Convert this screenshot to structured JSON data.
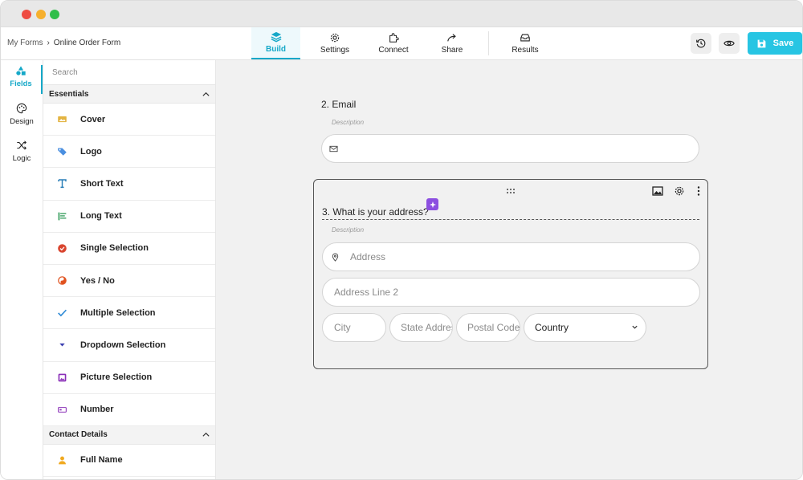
{
  "breadcrumb": {
    "root": "My Forms",
    "separator": "›",
    "current": "Online Order Form"
  },
  "nav_tabs": [
    {
      "label": "Build",
      "icon": "layers-icon",
      "active": true
    },
    {
      "label": "Settings",
      "icon": "gear-icon",
      "active": false
    },
    {
      "label": "Connect",
      "icon": "puzzle-icon",
      "active": false
    },
    {
      "label": "Share",
      "icon": "share-arrow-icon",
      "active": false
    },
    {
      "label": "Results",
      "icon": "inbox-icon",
      "active": false
    }
  ],
  "toolbar": {
    "history_icon": "history-icon",
    "preview_icon": "eye-icon",
    "save_label": "Save",
    "save_icon": "floppy-disk-icon"
  },
  "rail": [
    {
      "label": "Fields",
      "icon": "shapes-icon",
      "active": true
    },
    {
      "label": "Design",
      "icon": "palette-icon",
      "active": false
    },
    {
      "label": "Logic",
      "icon": "shuffle-icon",
      "active": false
    }
  ],
  "panel": {
    "search_placeholder": "Search",
    "sections": [
      {
        "title": "Essentials",
        "expanded": true,
        "items": [
          {
            "label": "Cover",
            "icon": "image-icon",
            "color": "#e3b341"
          },
          {
            "label": "Logo",
            "icon": "tag-icon",
            "color": "#4a8fe0"
          },
          {
            "label": "Short Text",
            "icon": "text-t-icon",
            "color": "#2a7fb8"
          },
          {
            "label": "Long Text",
            "icon": "align-left-icon",
            "color": "#2f9a57"
          },
          {
            "label": "Single Selection",
            "icon": "check-circle-icon",
            "color": "#d9452f"
          },
          {
            "label": "Yes / No",
            "icon": "yes-no-icon",
            "color": "#e0521f"
          },
          {
            "label": "Multiple Selection",
            "icon": "checkmark-icon",
            "color": "#2e8ad6"
          },
          {
            "label": "Dropdown Selection",
            "icon": "caret-down-icon",
            "color": "#3b3fb0"
          },
          {
            "label": "Picture Selection",
            "icon": "picture-icon",
            "color": "#8a2fb8"
          },
          {
            "label": "Number",
            "icon": "number-icon",
            "color": "#8a2fb8"
          }
        ]
      },
      {
        "title": "Contact Details",
        "expanded": true,
        "items": [
          {
            "label": "Full Name",
            "icon": "person-icon",
            "color": "#f0a91f"
          }
        ]
      }
    ]
  },
  "form": {
    "email_question": {
      "title": "2. Email",
      "description": "Description",
      "icon": "envelope-icon"
    },
    "address_question": {
      "title": "3. What is your address?",
      "description": "Description",
      "address_placeholder": "Address",
      "address_line2_placeholder": "Address Line 2",
      "city_placeholder": "City",
      "state_placeholder": "State Address",
      "postal_placeholder": "Postal Code",
      "country_value": "Country"
    }
  }
}
